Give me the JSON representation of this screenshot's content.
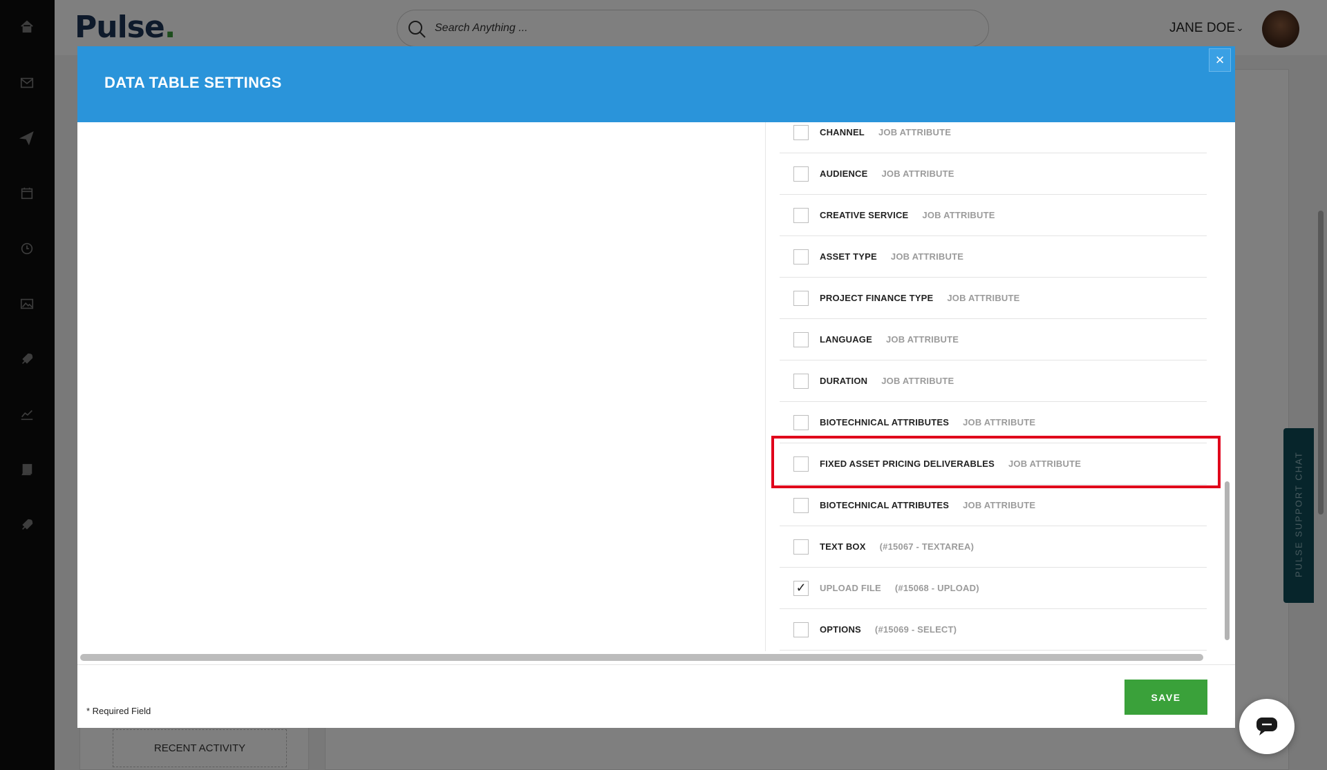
{
  "app": {
    "logo_text": "Pulse",
    "logo_dot": ".",
    "search_placeholder": "Search Anything ...",
    "user_name": "JANE DOE"
  },
  "sidebar": {
    "icons": [
      "home-icon",
      "mail-icon",
      "send-icon",
      "calendar-icon",
      "clock-icon",
      "image-icon",
      "rocket-icon",
      "chart-icon",
      "book-icon",
      "rocket-icon-2"
    ]
  },
  "background": {
    "recent_activity": "RECENT ACTIVITY",
    "support_chat": "PULSE SUPPORT CHAT"
  },
  "modal": {
    "title": "DATA TABLE SETTINGS",
    "close_glyph": "×",
    "required_note": "* Required Field",
    "save_label": "SAVE",
    "rows": [
      {
        "label": "CHANNEL",
        "sub": "JOB ATTRIBUTE",
        "checked": false
      },
      {
        "label": "AUDIENCE",
        "sub": "JOB ATTRIBUTE",
        "checked": false
      },
      {
        "label": "CREATIVE SERVICE",
        "sub": "JOB ATTRIBUTE",
        "checked": false
      },
      {
        "label": "ASSET TYPE",
        "sub": "JOB ATTRIBUTE",
        "checked": false
      },
      {
        "label": "PROJECT FINANCE TYPE",
        "sub": "JOB ATTRIBUTE",
        "checked": false
      },
      {
        "label": "LANGUAGE",
        "sub": "JOB ATTRIBUTE",
        "checked": false
      },
      {
        "label": "DURATION",
        "sub": "JOB ATTRIBUTE",
        "checked": false
      },
      {
        "label": "BIOTECHNICAL ATTRIBUTES",
        "sub": "JOB ATTRIBUTE",
        "checked": false
      },
      {
        "label": "FIXED ASSET PRICING DELIVERABLES",
        "sub": "JOB ATTRIBUTE",
        "checked": false
      },
      {
        "label": "BIOTECHNICAL ATTRIBUTES",
        "sub": "JOB ATTRIBUTE",
        "checked": false
      },
      {
        "label": "TEXT BOX",
        "sub": "(#15067 - TEXTAREA)",
        "checked": false
      },
      {
        "label": "UPLOAD FILE",
        "sub": "(#15068 - UPLOAD)",
        "checked": true
      },
      {
        "label": "OPTIONS",
        "sub": "(#15069 - SELECT)",
        "checked": false
      }
    ]
  },
  "colors": {
    "header_blue": "#2a94da",
    "save_green": "#3aa13a",
    "highlight_red": "#e0001b"
  }
}
